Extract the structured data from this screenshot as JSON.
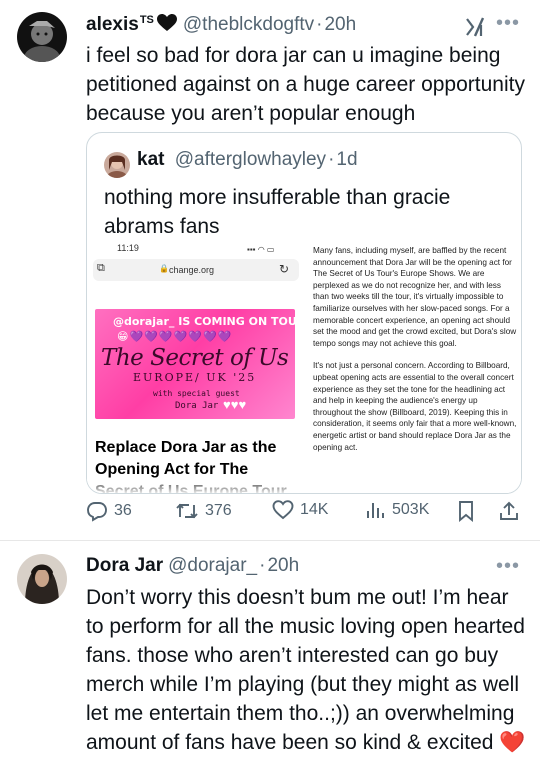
{
  "tweet1": {
    "name": "alexis",
    "name_sup": "TS",
    "handle": "@theblckdogftv",
    "time": "20h",
    "more_label": "•••",
    "text": "i feel so bad for dora jar can u imagine being petitioned against on a huge career opportunity because you aren’t popular enough"
  },
  "quote": {
    "name": "kat",
    "handle": "@afterglowhayley",
    "time": "1d",
    "text": "nothing more insufferable than gracie abrams fans",
    "media": {
      "status_time": "11:19",
      "url": "change.org",
      "banner_top": "@dorajar_ IS COMING ON TOUR😁",
      "banner_hearts": "😁💜💜💜💜💜💜💜",
      "banner_title": "The Secret of Us Tour",
      "banner_sub": "EUROPE/ UK '25",
      "banner_guest": "with special guest",
      "banner_dj": "Dora Jar",
      "banner_whearts": "♥♥♥",
      "petition_title": "Replace Dora Jar as the Opening Act for The Secret of Us Europe Tour",
      "article_p1": "Many fans, including myself, are baffled by the recent announcement that Dora Jar will be the opening act for The Secret of Us Tour's Europe Shows. We are perplexed as we do not recognize her, and with less than two weeks till the tour, it's virtually impossible to familiarize ourselves with her slow-paced songs. For a memorable concert experience, an opening act should set the mood and get the crowd excited, but Dora's slow tempo songs may not achieve this goal.",
      "article_p2": "It's not just a personal concern. According to Billboard, upbeat opening acts are essential to the overall concert experience as they set the tone for the headlining act and help in keeping the audience's energy up throughout the show (Billboard, 2019). Keeping this in consideration, it seems only fair that a more well-known, energetic artist or band should replace Dora Jar as the opening act."
    }
  },
  "actions": {
    "replies": "36",
    "reposts": "376",
    "likes": "14K",
    "views": "503K"
  },
  "tweet2": {
    "name": "Dora Jar",
    "handle": "@dorajar_",
    "time": "20h",
    "more_label": "•••",
    "text": "Don’t worry this doesn’t bum me out! I’m hear to perform for all the music loving open hearted fans. those who aren’t interested can go buy merch while I’m playing (but they might as well let me entertain them tho..;)) an overwhelming amount of fans have been so kind & excited ❤️"
  },
  "colors": {
    "text": "#0f1419",
    "secondary": "#536471",
    "border": "#cfd9de",
    "banner_pink": "#ff3ea5",
    "red_heart": "#e0245e"
  },
  "icons": [
    "black-heart-icon",
    "grok-icon",
    "more-icon",
    "reply-icon",
    "repost-icon",
    "like-icon",
    "views-icon",
    "bookmark-icon",
    "share-icon"
  ]
}
